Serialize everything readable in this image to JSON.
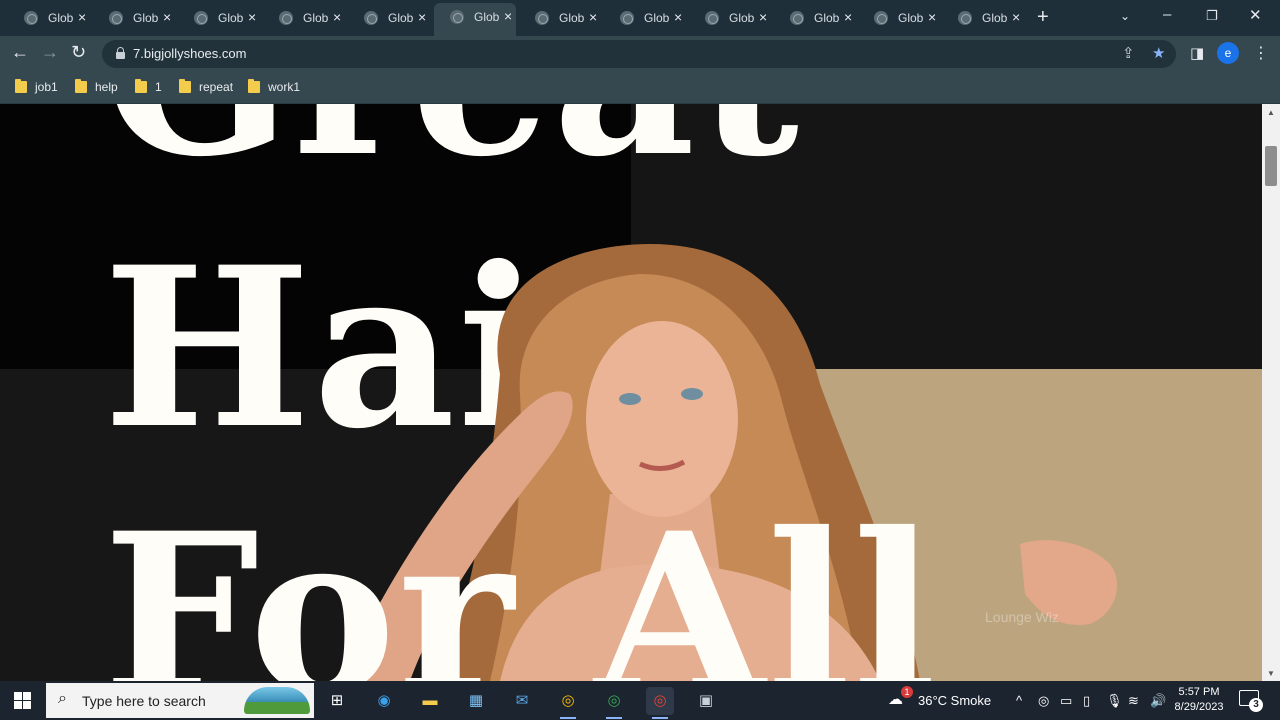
{
  "browser": {
    "tabs": [
      {
        "title": "Glob",
        "active": false
      },
      {
        "title": "Glob",
        "active": false
      },
      {
        "title": "Glob",
        "active": false
      },
      {
        "title": "Glob",
        "active": false
      },
      {
        "title": "Glob",
        "active": false
      },
      {
        "title": "Glob",
        "active": true
      },
      {
        "title": "Glob",
        "active": false
      },
      {
        "title": "Glob",
        "active": false
      },
      {
        "title": "Glob",
        "active": false
      },
      {
        "title": "Glob",
        "active": false
      },
      {
        "title": "Glob",
        "active": false
      },
      {
        "title": "Glob",
        "active": false
      }
    ],
    "url": "7.bigjollyshoes.com",
    "profile_initial": "e",
    "bookmarks": [
      "job1",
      "help",
      "1",
      "repeat",
      "work1"
    ]
  },
  "page": {
    "hero_lines": [
      "Great",
      "Hair",
      "For All"
    ],
    "watermark": "Lounge Wiz",
    "colors": {
      "dark": "#040404",
      "panel": "#151515",
      "accent_beige": "#bca47e",
      "hero_text": "#fffdf8"
    }
  },
  "taskbar": {
    "search_placeholder": "Type here to search",
    "weather": "36°C  Smoke",
    "weather_badge": "1",
    "time": "5:57 PM",
    "date": "8/29/2023",
    "notification_count": "3"
  }
}
